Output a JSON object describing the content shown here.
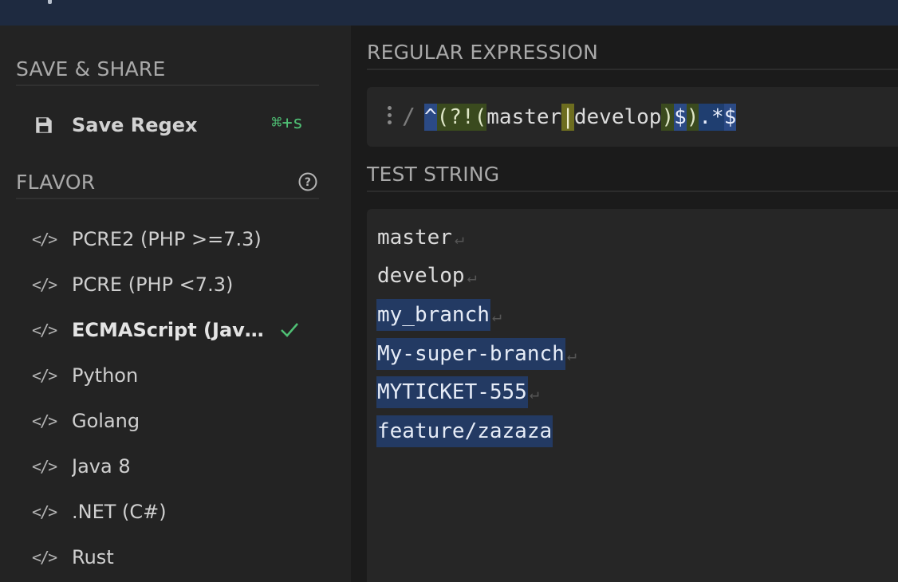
{
  "colors": {
    "topbar": "#1e2a40",
    "sidebar": "#232323",
    "accent_green": "#4fbf74",
    "match_highlight": "#233a63"
  },
  "sidebar": {
    "save_share_header": "SAVE & SHARE",
    "save_label": "Save Regex",
    "save_shortcut": "⌘+s",
    "save_icon": "floppy-disk-icon",
    "flavor_header": "FLAVOR",
    "help_icon": "question-circle-icon",
    "flavors": [
      {
        "label": "PCRE2 (PHP >=7.3)",
        "icon": "code-icon",
        "selected": false
      },
      {
        "label": "PCRE (PHP <7.3)",
        "icon": "code-icon",
        "selected": false
      },
      {
        "label": "ECMAScript (JavaScript)",
        "icon": "code-icon",
        "selected": true
      },
      {
        "label": "Python",
        "icon": "code-icon",
        "selected": false
      },
      {
        "label": "Golang",
        "icon": "code-icon",
        "selected": false
      },
      {
        "label": "Java 8",
        "icon": "code-icon",
        "selected": false
      },
      {
        "label": ".NET (C#)",
        "icon": "code-icon",
        "selected": false
      },
      {
        "label": "Rust",
        "icon": "code-icon",
        "selected": false
      }
    ],
    "code_glyph": "</>"
  },
  "regex": {
    "header": "REGULAR EXPRESSION",
    "delimiter": "/",
    "tokens": [
      {
        "text": "^",
        "kind": "anchor"
      },
      {
        "text": "(?!",
        "kind": "group"
      },
      {
        "text": "(",
        "kind": "group"
      },
      {
        "text": "master",
        "kind": "lit"
      },
      {
        "text": "|",
        "kind": "alt"
      },
      {
        "text": "develop",
        "kind": "lit"
      },
      {
        "text": ")",
        "kind": "group"
      },
      {
        "text": "$",
        "kind": "anchor"
      },
      {
        "text": ")",
        "kind": "group"
      },
      {
        "text": ".*",
        "kind": "any"
      },
      {
        "text": "$",
        "kind": "anchor"
      }
    ]
  },
  "test": {
    "header": "TEST STRING",
    "newline_symbol": "↵",
    "lines": [
      {
        "text": "master",
        "match": false,
        "newline": true
      },
      {
        "text": "develop",
        "match": false,
        "newline": true
      },
      {
        "text": "my_branch",
        "match": true,
        "newline": true
      },
      {
        "text": "My-super-branch",
        "match": true,
        "newline": true
      },
      {
        "text": "MYTICKET-555",
        "match": true,
        "newline": true
      },
      {
        "text": "feature/zazaza",
        "match": true,
        "newline": false
      }
    ]
  }
}
